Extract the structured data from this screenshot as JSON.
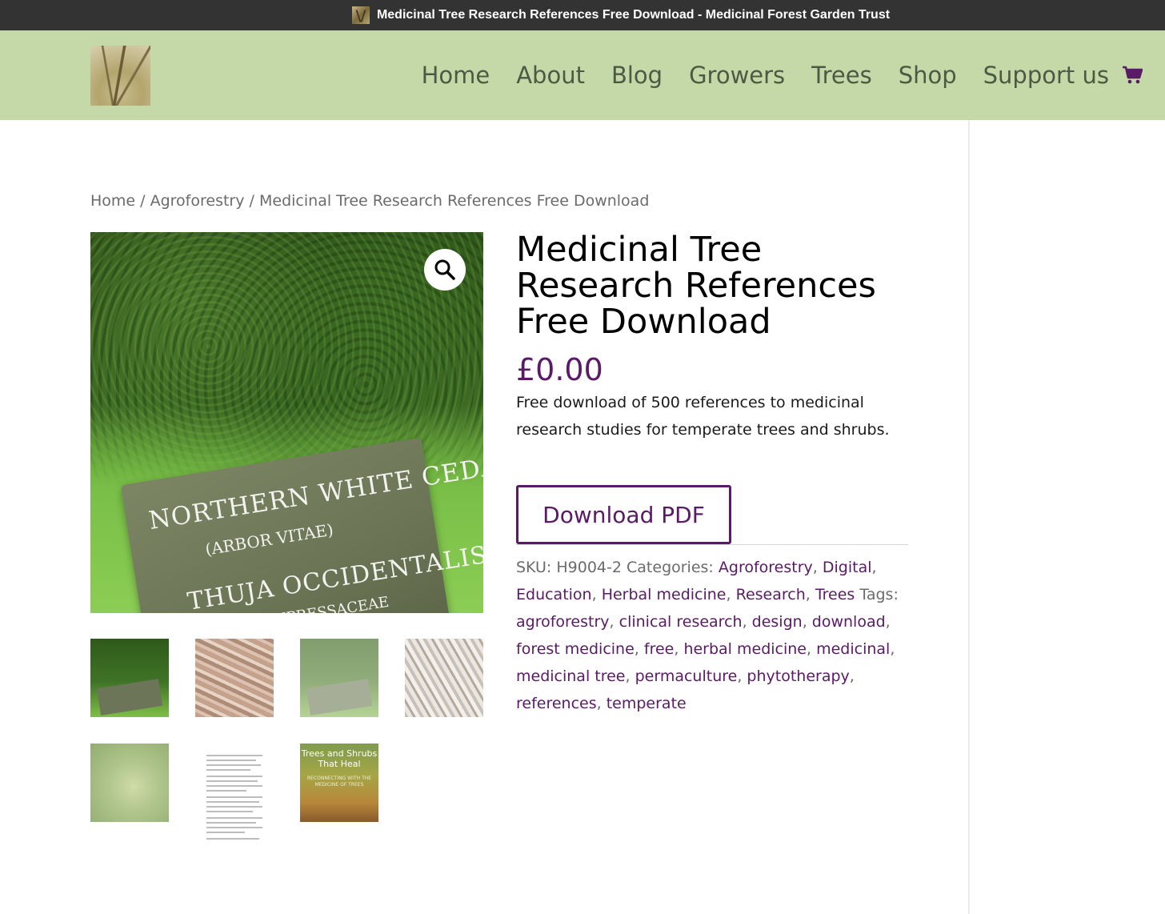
{
  "window": {
    "title": "Medicinal Tree Research References Free Download - Medicinal Forest Garden Trust"
  },
  "nav": {
    "items": [
      "Home",
      "About",
      "Blog",
      "Growers",
      "Trees",
      "Shop",
      "Support us"
    ]
  },
  "breadcrumb": {
    "items": [
      "Home",
      "Agroforestry",
      "Medicinal Tree Research References Free Download"
    ],
    "separator": "/"
  },
  "gallery": {
    "sign_text": [
      "NORTHERN WHITE CEDAR",
      "(ARBOR VITAE)",
      "THUJA OCCIDENTALIS",
      "CUPRESSACEAE"
    ],
    "book_title": "Trees and Shrubs That Heal",
    "book_subtitle": "RECONNECTING WITH THE MEDICINE OF TREES"
  },
  "product": {
    "title": "Medicinal Tree Research References Free Download",
    "price": "£0.00",
    "description": "Free download of 500 references to medicinal research studies for temperate trees and shrubs.",
    "button_label": "Download PDF",
    "sku_label": "SKU:",
    "sku": "H9004-2",
    "categories_label": "Categories:",
    "categories": [
      "Agroforestry",
      "Digital",
      "Education",
      "Herbal medicine",
      "Research",
      "Trees"
    ],
    "tags_label": "Tags:",
    "tags": [
      "agroforestry",
      "clinical research",
      "design",
      "download",
      "forest medicine",
      "free",
      "herbal medicine",
      "medicinal",
      "medicinal tree",
      "permaculture",
      "phytotherapy",
      "references",
      "temperate"
    ]
  },
  "colors": {
    "header_bg": "#c5d9a8",
    "accent": "#5a1a66",
    "nav_text": "#4c5a43",
    "titlebar_bg": "#333333"
  },
  "icons": {
    "zoom": "magnifier-icon",
    "cart": "cart-icon"
  }
}
